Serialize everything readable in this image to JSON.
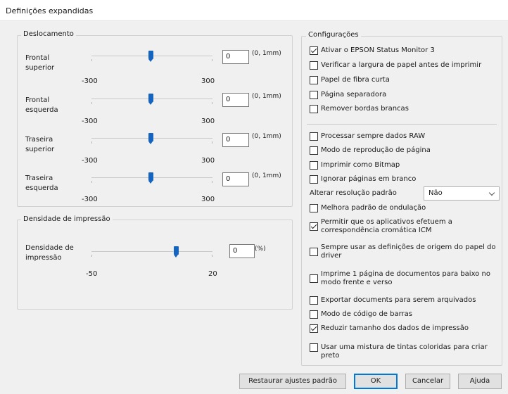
{
  "window": {
    "title": "Definições expandidas"
  },
  "deslocamento": {
    "label": "Deslocamento",
    "min_label": "-300",
    "max_label": "300",
    "unit": "(0, 1mm)",
    "rows": [
      {
        "label": "Frontal\nsuperior",
        "value": "0"
      },
      {
        "label": "Frontal\nesquerda",
        "value": "0"
      },
      {
        "label": "Traseira\nsuperior",
        "value": "0"
      },
      {
        "label": "Traseira\nesquerda",
        "value": "0"
      }
    ]
  },
  "densidade": {
    "label": "Densidade de impressão",
    "row_label": "Densidade de\nimpressão",
    "value": "0",
    "unit": "(%)",
    "min_label": "-50",
    "max_label": "20"
  },
  "configuracoes": {
    "label": "Configurações",
    "group1": [
      {
        "label": "Ativar o EPSON Status Monitor 3",
        "checked": true
      },
      {
        "label": "Verificar a largura de papel antes de imprimir",
        "checked": false
      },
      {
        "label": "Papel de fibra curta",
        "checked": false
      },
      {
        "label": "Página separadora",
        "checked": false
      },
      {
        "label": "Remover bordas brancas",
        "checked": false
      }
    ],
    "group2a": [
      {
        "label": "Processar sempre dados RAW",
        "checked": false
      },
      {
        "label": "Modo de reprodução de página",
        "checked": false
      },
      {
        "label": "Imprimir como Bitmap",
        "checked": false
      },
      {
        "label": "Ignorar páginas em branco",
        "checked": false
      }
    ],
    "resolution_label": "Alterar resolução padrão",
    "resolution_value": "Não",
    "group2b": [
      {
        "label": "Melhora padrão de ondulação",
        "checked": false
      },
      {
        "label": "Permitir que os aplicativos efetuem a\ncorrespondência cromática ICM",
        "checked": true
      },
      {
        "label": "Sempre usar as definições de origem do papel do\ndriver",
        "checked": false
      },
      {
        "label": "Imprime 1 página de documentos para baixo no\nmodo frente e verso",
        "checked": false
      },
      {
        "label": "Exportar documents para serem arquivados",
        "checked": false
      },
      {
        "label": "Modo de código de barras",
        "checked": false
      },
      {
        "label": "Reduzir tamanho dos dados de impressão",
        "checked": true
      },
      {
        "label": "Usar uma mistura de tintas coloridas para criar preto",
        "checked": false
      }
    ]
  },
  "buttons": {
    "restore": "Restaurar ajustes padrão",
    "ok": "OK",
    "cancel": "Cancelar",
    "help": "Ajuda"
  },
  "colors": {
    "accent": "#1565c0",
    "default_button_border": "#0078d7"
  }
}
